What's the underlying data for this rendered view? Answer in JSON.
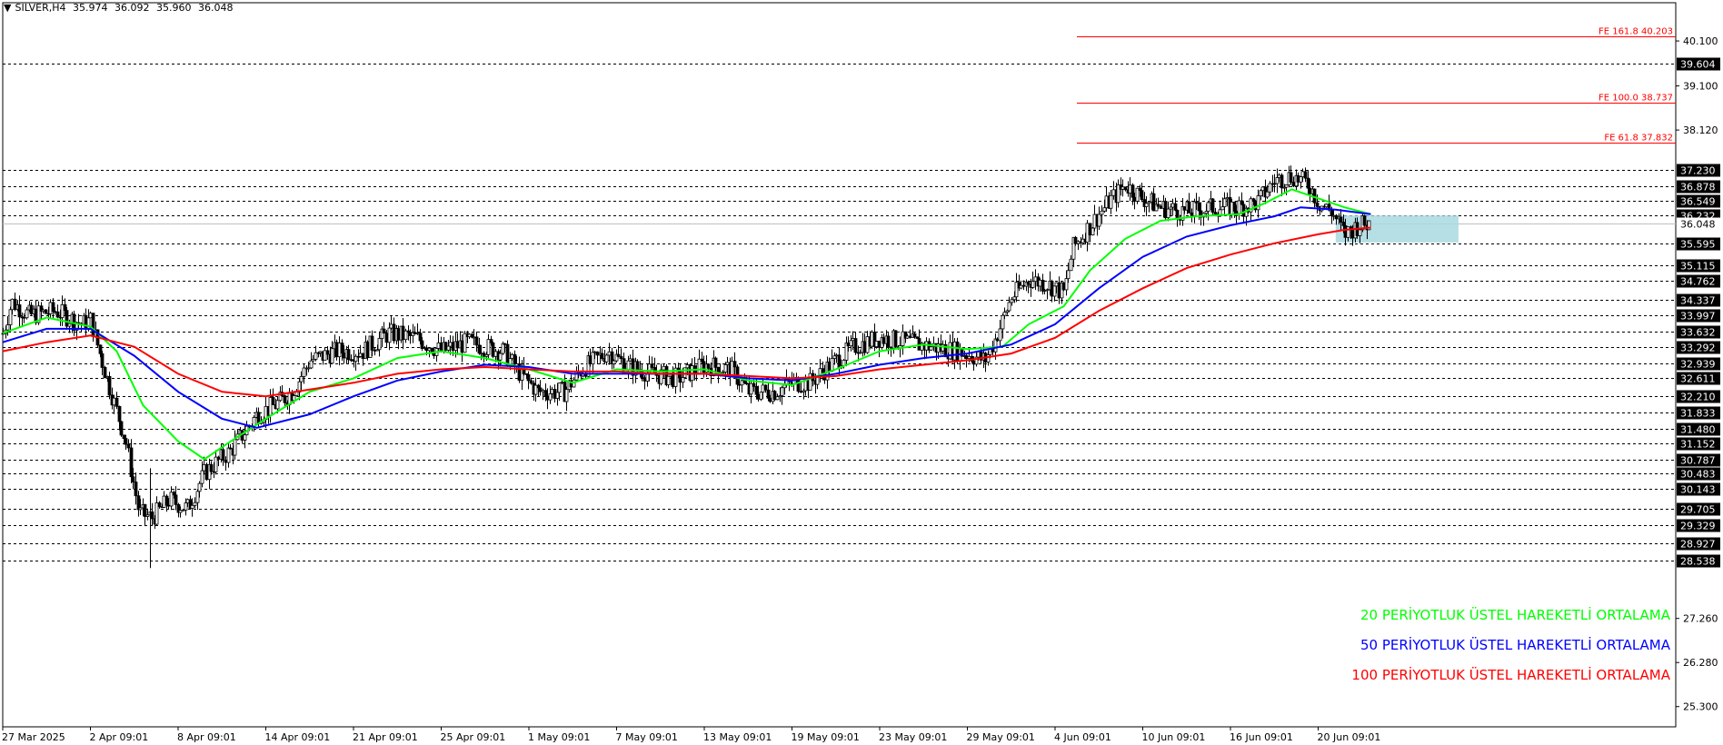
{
  "header": {
    "symbol_label": "SILVER,H4",
    "ohlc": [
      "35.974",
      "36.092",
      "35.960",
      "36.048"
    ]
  },
  "legend": {
    "ema20": "20 PERİYOTLUK ÜSTEL HAREKETLİ ORTALAMA",
    "ema50": "50 PERİYOTLUK ÜSTEL HAREKETLİ ORTALAMA",
    "ema100": "100 PERİYOTLUK ÜSTEL HAREKETLİ ORTALAMA"
  },
  "colors": {
    "ema20": "#00ff00",
    "ema50": "#0000ff",
    "ema100": "#ff0000",
    "fe_line": "#ff0000",
    "zone": "#a8d8e0",
    "candle": "#000000"
  },
  "chart_data": {
    "type": "line",
    "title": "SILVER,H4",
    "ylim": [
      24.85,
      40.95
    ],
    "price_axis_ticks": [
      "40.100",
      "39.100",
      "38.120",
      "27.260",
      "26.280",
      "25.300"
    ],
    "x_labels": [
      "27 Mar 2025",
      "2 Apr 09:01",
      "8 Apr 09:01",
      "14 Apr 09:01",
      "21 Apr 09:01",
      "25 Apr 09:01",
      "1 May 09:01",
      "7 May 09:01",
      "13 May 09:01",
      "19 May 09:01",
      "23 May 09:01",
      "29 May 09:01",
      "4 Jun 09:01",
      "10 Jun 09:01",
      "16 Jun 09:01",
      "20 Jun 09:01"
    ],
    "horizontal_levels": [
      "39.604",
      "37.230",
      "36.878",
      "36.549",
      "36.232",
      "35.595",
      "35.115",
      "34.762",
      "34.337",
      "33.997",
      "33.632",
      "33.292",
      "32.939",
      "32.611",
      "32.210",
      "31.833",
      "31.480",
      "31.152",
      "30.787",
      "30.483",
      "30.143",
      "29.705",
      "29.329",
      "28.927",
      "28.538"
    ],
    "current_price": "36.048",
    "fibonacci_extensions": [
      {
        "label": "FE 161.8 40.203",
        "value": 40.203
      },
      {
        "label": "FE 100.0 38.737",
        "value": 38.737
      },
      {
        "label": "FE 61.8 37.832",
        "value": 37.832
      }
    ],
    "zone": {
      "top": 36.22,
      "bottom": 35.62,
      "from_index": 15.2,
      "to_index": 16.6
    },
    "price_path": [
      [
        0,
        33.6
      ],
      [
        0.1,
        34.3
      ],
      [
        0.3,
        34.0
      ],
      [
        0.6,
        34.1
      ],
      [
        0.9,
        33.8
      ],
      [
        1.0,
        33.9
      ],
      [
        1.2,
        32.5
      ],
      [
        1.4,
        31.2
      ],
      [
        1.55,
        29.6
      ],
      [
        1.7,
        29.5
      ],
      [
        1.9,
        29.9
      ],
      [
        2.1,
        29.7
      ],
      [
        2.3,
        30.5
      ],
      [
        2.6,
        31.0
      ],
      [
        2.9,
        31.8
      ],
      [
        3.1,
        32.0
      ],
      [
        3.3,
        32.3
      ],
      [
        3.5,
        33.0
      ],
      [
        3.8,
        33.2
      ],
      [
        4.1,
        33.2
      ],
      [
        4.4,
        33.6
      ],
      [
        4.7,
        33.5
      ],
      [
        5.0,
        33.2
      ],
      [
        5.3,
        33.4
      ],
      [
        5.7,
        33.2
      ],
      [
        5.9,
        32.7
      ],
      [
        6.1,
        32.3
      ],
      [
        6.4,
        32.3
      ],
      [
        6.6,
        32.8
      ],
      [
        6.9,
        33.2
      ],
      [
        7.1,
        32.9
      ],
      [
        7.4,
        32.7
      ],
      [
        7.7,
        32.6
      ],
      [
        8.0,
        32.9
      ],
      [
        8.3,
        32.8
      ],
      [
        8.5,
        32.3
      ],
      [
        8.8,
        32.3
      ],
      [
        9.0,
        32.5
      ],
      [
        9.2,
        32.5
      ],
      [
        9.5,
        33.0
      ],
      [
        9.7,
        33.3
      ],
      [
        10.0,
        33.5
      ],
      [
        10.3,
        33.4
      ],
      [
        10.6,
        33.3
      ],
      [
        10.9,
        33.2
      ],
      [
        11.2,
        33.0
      ],
      [
        11.3,
        33.4
      ],
      [
        11.5,
        34.4
      ],
      [
        11.7,
        34.8
      ],
      [
        11.9,
        34.7
      ],
      [
        12.1,
        34.5
      ],
      [
        12.2,
        35.5
      ],
      [
        12.4,
        36.0
      ],
      [
        12.6,
        36.5
      ],
      [
        12.8,
        36.9
      ],
      [
        13.0,
        36.6
      ],
      [
        13.2,
        36.4
      ],
      [
        13.5,
        36.3
      ],
      [
        13.8,
        36.4
      ],
      [
        14.1,
        36.4
      ],
      [
        14.3,
        36.5
      ],
      [
        14.5,
        37.0
      ],
      [
        14.7,
        37.1
      ],
      [
        14.9,
        36.9
      ],
      [
        15.0,
        36.5
      ],
      [
        15.15,
        36.3
      ],
      [
        15.3,
        35.8
      ],
      [
        15.45,
        36.0
      ],
      [
        15.6,
        36.05
      ]
    ],
    "series": [
      {
        "name": "20 PERİYOTLUK ÜSTEL HAREKETLİ ORTALAMA",
        "color": "#00ff00",
        "points": [
          [
            0,
            33.6
          ],
          [
            0.5,
            33.95
          ],
          [
            1.0,
            33.75
          ],
          [
            1.3,
            33.2
          ],
          [
            1.6,
            32.0
          ],
          [
            2.0,
            31.2
          ],
          [
            2.3,
            30.8
          ],
          [
            2.6,
            31.2
          ],
          [
            3.0,
            31.7
          ],
          [
            3.5,
            32.3
          ],
          [
            4.0,
            32.6
          ],
          [
            4.5,
            33.05
          ],
          [
            5.0,
            33.2
          ],
          [
            5.5,
            33.05
          ],
          [
            6.0,
            32.8
          ],
          [
            6.5,
            32.5
          ],
          [
            7.0,
            32.8
          ],
          [
            7.5,
            32.75
          ],
          [
            8.0,
            32.8
          ],
          [
            8.5,
            32.55
          ],
          [
            9.0,
            32.45
          ],
          [
            9.5,
            32.8
          ],
          [
            10.0,
            33.2
          ],
          [
            10.5,
            33.35
          ],
          [
            11.0,
            33.25
          ],
          [
            11.4,
            33.3
          ],
          [
            11.7,
            33.8
          ],
          [
            12.1,
            34.2
          ],
          [
            12.4,
            35.0
          ],
          [
            12.8,
            35.7
          ],
          [
            13.2,
            36.1
          ],
          [
            13.6,
            36.2
          ],
          [
            14.1,
            36.25
          ],
          [
            14.4,
            36.5
          ],
          [
            14.7,
            36.8
          ],
          [
            15.0,
            36.6
          ],
          [
            15.3,
            36.4
          ],
          [
            15.6,
            36.25
          ]
        ]
      },
      {
        "name": "50 PERİYOTLUK ÜSTEL HAREKETLİ ORTALAMA",
        "color": "#0000ff",
        "points": [
          [
            0,
            33.4
          ],
          [
            0.5,
            33.7
          ],
          [
            1.0,
            33.7
          ],
          [
            1.5,
            33.1
          ],
          [
            2.0,
            32.3
          ],
          [
            2.5,
            31.7
          ],
          [
            2.9,
            31.5
          ],
          [
            3.5,
            31.8
          ],
          [
            4.0,
            32.2
          ],
          [
            4.5,
            32.55
          ],
          [
            5.0,
            32.75
          ],
          [
            5.5,
            32.9
          ],
          [
            6.0,
            32.85
          ],
          [
            6.5,
            32.7
          ],
          [
            7.0,
            32.7
          ],
          [
            7.5,
            32.7
          ],
          [
            8.0,
            32.7
          ],
          [
            8.5,
            32.6
          ],
          [
            9.0,
            32.55
          ],
          [
            9.5,
            32.7
          ],
          [
            10.0,
            32.9
          ],
          [
            10.5,
            33.05
          ],
          [
            11.0,
            33.15
          ],
          [
            11.5,
            33.35
          ],
          [
            12.0,
            33.8
          ],
          [
            12.5,
            34.6
          ],
          [
            13.0,
            35.3
          ],
          [
            13.5,
            35.75
          ],
          [
            14.0,
            36.0
          ],
          [
            14.5,
            36.2
          ],
          [
            14.8,
            36.4
          ],
          [
            15.2,
            36.35
          ],
          [
            15.6,
            36.25
          ]
        ]
      },
      {
        "name": "100 PERİYOTLUK ÜSTEL HAREKETLİ ORTALAMA",
        "color": "#ff0000",
        "points": [
          [
            0,
            33.2
          ],
          [
            0.5,
            33.4
          ],
          [
            1.0,
            33.55
          ],
          [
            1.5,
            33.3
          ],
          [
            2.0,
            32.7
          ],
          [
            2.5,
            32.3
          ],
          [
            3.0,
            32.2
          ],
          [
            3.5,
            32.35
          ],
          [
            4.0,
            32.5
          ],
          [
            4.5,
            32.7
          ],
          [
            5.0,
            32.8
          ],
          [
            5.5,
            32.85
          ],
          [
            6.0,
            32.8
          ],
          [
            6.5,
            32.75
          ],
          [
            7.0,
            32.75
          ],
          [
            7.5,
            32.7
          ],
          [
            8.0,
            32.7
          ],
          [
            8.5,
            32.65
          ],
          [
            9.0,
            32.6
          ],
          [
            9.5,
            32.65
          ],
          [
            10.0,
            32.8
          ],
          [
            10.5,
            32.9
          ],
          [
            11.0,
            33.0
          ],
          [
            11.5,
            33.15
          ],
          [
            12.0,
            33.5
          ],
          [
            12.5,
            34.1
          ],
          [
            13.0,
            34.6
          ],
          [
            13.5,
            35.05
          ],
          [
            14.0,
            35.35
          ],
          [
            14.5,
            35.6
          ],
          [
            15.0,
            35.8
          ],
          [
            15.3,
            35.9
          ],
          [
            15.6,
            35.95
          ]
        ]
      }
    ]
  }
}
